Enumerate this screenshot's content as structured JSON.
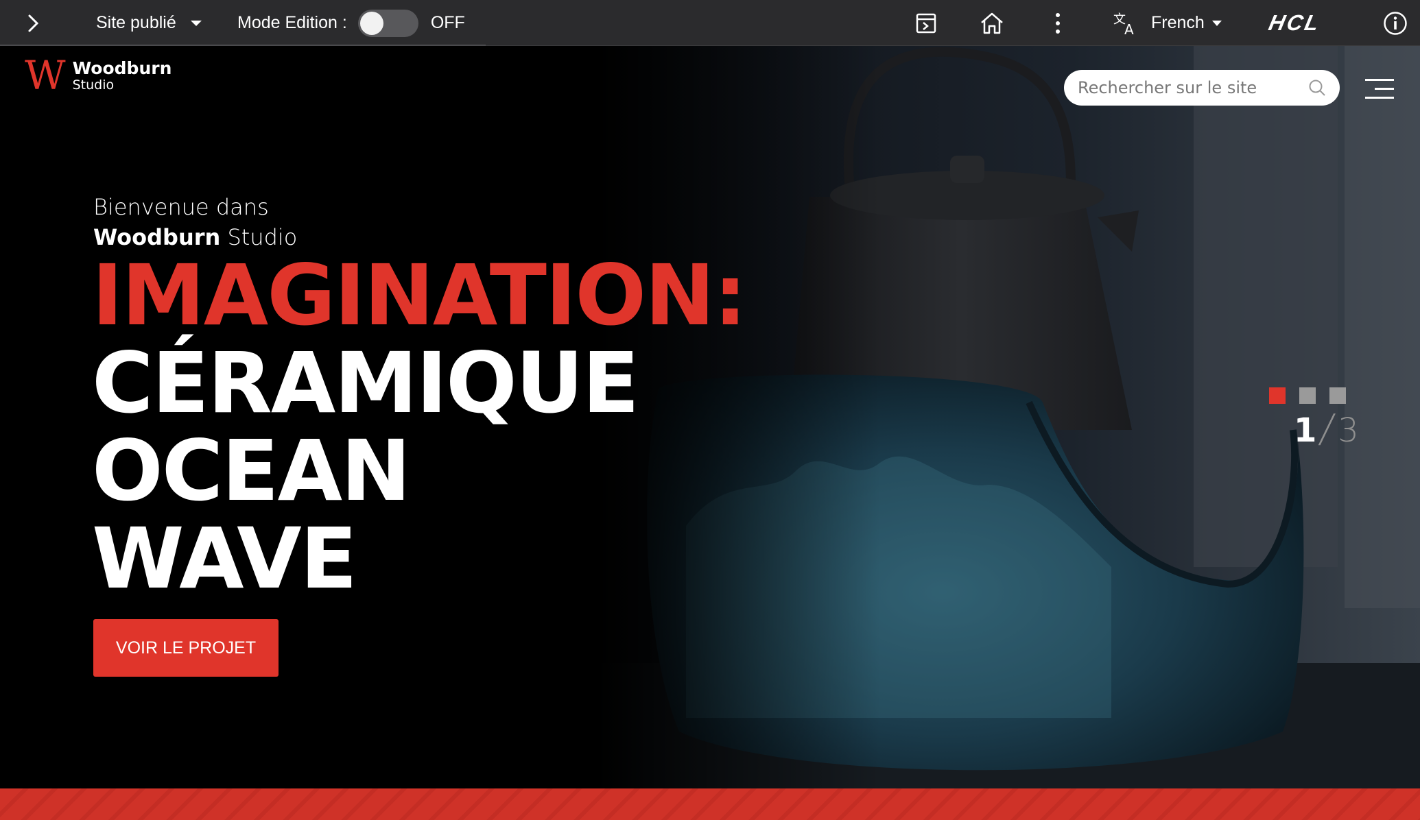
{
  "toolbar": {
    "site_status": "Site publié",
    "edit_mode_label": "Mode Edition :",
    "edit_mode_state": "OFF",
    "edit_mode_on": false,
    "language": "French",
    "brand": "HCL"
  },
  "header": {
    "logo_mark": "W",
    "logo_name": "Woodburn",
    "logo_sub": "Studio",
    "search_placeholder": "Rechercher sur le site"
  },
  "hero": {
    "intro_line1": "Bienvenue dans",
    "intro_brand_bold": "Woodburn",
    "intro_brand_rest": "Studio",
    "headline_red": "IMAGINATION:",
    "headline_lines": [
      "CÉRAMIQUE",
      "OCEAN",
      "WAVE"
    ],
    "cta_label": "VOIR LE PROJET",
    "slide_current": "1",
    "slide_separator": "/",
    "slide_total": "3",
    "slide_active_index": 0
  },
  "colors": {
    "accent": "#e0352b",
    "toolbar_bg": "#2b2b2d"
  }
}
